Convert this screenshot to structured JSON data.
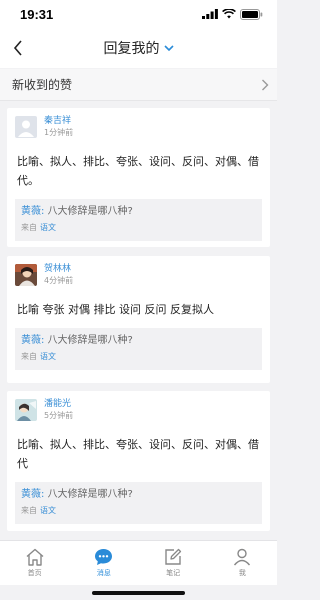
{
  "status": {
    "time": "19:31"
  },
  "nav": {
    "title": "回复我的"
  },
  "likes": {
    "label": "新收到的赞"
  },
  "cards": [
    {
      "author": "秦吉祥",
      "time": "1分钟前",
      "content": "比喻、拟人、排比、夸张、设问、反问、对偶、借代。",
      "quote_user": "黄薇:",
      "quote_text": "八大修辞是哪八种?",
      "from_label": "来自",
      "from_source": "语文"
    },
    {
      "author": "贺林林",
      "time": "4分钟前",
      "content": "比喻 夸张 对偶 排比 设问 反问 反复拟人",
      "quote_user": "黄薇:",
      "quote_text": "八大修辞是哪八种?",
      "from_label": "来自",
      "from_source": "语文"
    },
    {
      "author": "潘能光",
      "time": "5分钟前",
      "content": "比喻、拟人、排比、夸张、设问、反问、对偶、借代",
      "quote_user": "黄薇:",
      "quote_text": "八大修辞是哪八种?",
      "from_label": "来自",
      "from_source": "语文"
    }
  ],
  "tabs": [
    {
      "label": "首页",
      "icon": "home-icon",
      "active": false
    },
    {
      "label": "消息",
      "icon": "chat-bubble-icon",
      "active": true
    },
    {
      "label": "笔记",
      "icon": "note-edit-icon",
      "active": false
    },
    {
      "label": "我",
      "icon": "user-icon",
      "active": false
    }
  ],
  "colors": {
    "accent": "#3a8fd6",
    "background": "#f2f2f4"
  }
}
